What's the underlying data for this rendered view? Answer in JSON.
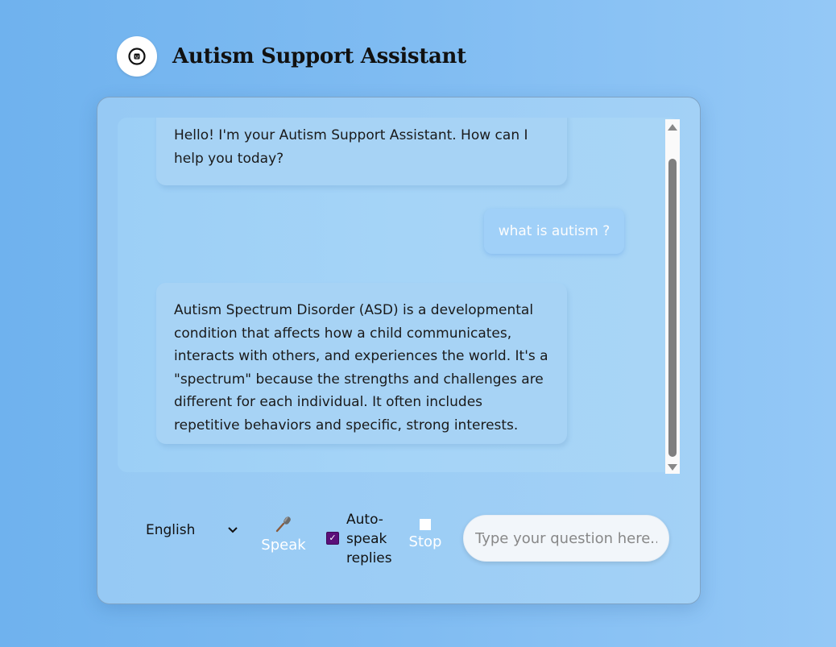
{
  "header": {
    "title": "Autism Support Assistant",
    "logo_icon": "robot-icon"
  },
  "chat": {
    "messages": [
      {
        "role": "assistant",
        "text": "Hello! I'm your Autism Support Assistant. How can I help you today?"
      },
      {
        "role": "user",
        "text": "what is autism ?"
      },
      {
        "role": "assistant",
        "text": "Autism Spectrum Disorder (ASD) is a developmental condition that affects how a child communicates, interacts with others, and experiences the world. It's a \"spectrum\" because the strengths and challenges are different for each individual. It often includes repetitive behaviors and specific, strong interests."
      }
    ]
  },
  "controls": {
    "language": "English",
    "speak_label": "Speak",
    "speak_icon": "microphone-icon",
    "autospeak_label": "Auto-speak replies",
    "autospeak_checked": true,
    "stop_label": "Stop",
    "stop_icon": "stop-square-icon",
    "input_placeholder": "Type your question here..."
  },
  "colors": {
    "checkbox_accent": "#5b0f7a",
    "user_bubble": "#a0d0f8"
  }
}
